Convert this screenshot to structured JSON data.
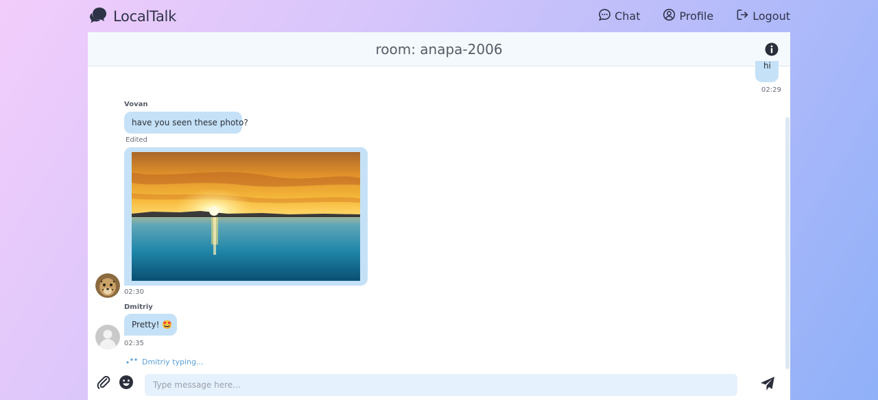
{
  "app": {
    "name": "LocalTalk",
    "icon": "chat-bubbles-logo-icon"
  },
  "nav": {
    "items": [
      {
        "label": "Chat",
        "icon": "chat-icon"
      },
      {
        "label": "Profile",
        "icon": "profile-icon"
      },
      {
        "label": "Logout",
        "icon": "logout-icon"
      }
    ]
  },
  "room": {
    "title": "room: anapa-2006",
    "info_icon": "info-icon"
  },
  "messages": [
    {
      "own": true,
      "text": "hi",
      "time": "02:29"
    },
    {
      "sender": "Vovan",
      "text": "have you seen these photo?",
      "edited_label": "Edited",
      "image": "sunset-over-sea-photo",
      "time": "02:30",
      "avatar": "cheetah-avatar"
    },
    {
      "sender": "Dmitriy",
      "text": "Pretty! 🤩",
      "time": "02:35",
      "avatar": "default-user-avatar"
    }
  ],
  "typing": {
    "text": "Dmitriy typing..."
  },
  "composer": {
    "placeholder": "Type message here...",
    "attach_icon": "paperclip-icon",
    "emoji_icon": "smiley-icon",
    "send_icon": "send-icon"
  },
  "colors": {
    "bubble": "#c5e1f7",
    "header_bg": "#f4f9fd",
    "input_bg": "#e5f1fd",
    "typing_text": "#5b9fd4",
    "text_dark": "#2f3348"
  }
}
